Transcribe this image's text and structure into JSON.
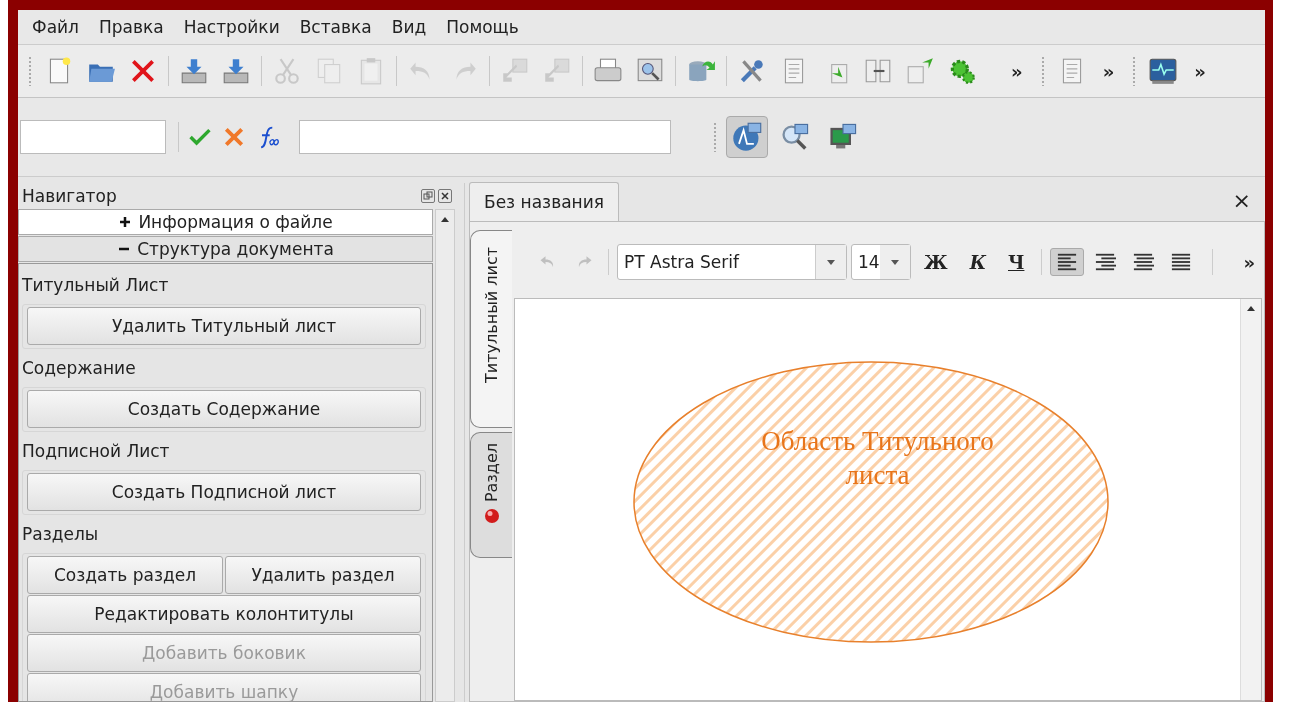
{
  "menu": [
    {
      "label": "Файл"
    },
    {
      "label": "Правка"
    },
    {
      "label": "Настройки"
    },
    {
      "label": "Вставка"
    },
    {
      "label": "Вид"
    },
    {
      "label": "Помощь"
    }
  ],
  "toolbars": [
    {
      "groups": [
        [
          {
            "disabled": false
          },
          {
            "disabled": false
          },
          {
            "disabled": false
          }
        ],
        [
          {
            "disabled": false
          },
          {
            "disabled": false
          }
        ],
        [
          {
            "disabled": true
          },
          {
            "disabled": true
          },
          {
            "disabled": true
          }
        ],
        [
          {
            "disabled": true
          },
          {
            "disabled": true
          }
        ],
        [
          {
            "disabled": true
          },
          {
            "disabled": true
          }
        ],
        [
          {
            "disabled": false
          },
          {
            "disabled": false
          }
        ],
        [
          {
            "disabled": false
          }
        ],
        [
          {
            "disabled": false
          },
          {
            "disabled": false
          },
          {
            "disabled": false
          },
          {
            "disabled": false
          },
          {
            "disabled": false
          },
          {
            "disabled": false
          }
        ]
      ],
      "overflow": "»"
    },
    {
      "groups": [
        [
          {
            "disabled": false
          }
        ]
      ],
      "overflow": "»"
    },
    {
      "groups": [
        [
          {
            "disabled": false
          }
        ]
      ],
      "overflow": "»"
    }
  ],
  "view_buttons": [
    {
      "selected": true
    },
    {
      "selected": false
    },
    {
      "selected": false
    }
  ],
  "navigator": {
    "title": "Навигатор",
    "sections": [
      {
        "label": "Информация о файле",
        "expanded": false
      },
      {
        "label": "Структура документа",
        "expanded": true,
        "groups": [
          {
            "label": "Титульный Лист",
            "rows": [
              [
                {
                  "label": "Удалить Титульный лист",
                  "disabled": false
                }
              ]
            ]
          },
          {
            "label": "Содержание",
            "rows": [
              [
                {
                  "label": "Создать Содержание",
                  "disabled": false
                }
              ]
            ]
          },
          {
            "label": "Подписной Лист",
            "rows": [
              [
                {
                  "label": "Создать Подписной лист",
                  "disabled": false
                }
              ]
            ]
          },
          {
            "label": "Разделы",
            "rows": [
              [
                {
                  "label": "Создать раздел",
                  "disabled": false
                },
                {
                  "label": "Удалить раздел",
                  "disabled": false
                }
              ],
              [
                {
                  "label": "Редактировать колонтитулы",
                  "disabled": false
                }
              ],
              [
                {
                  "label": "Добавить боковик",
                  "disabled": true
                }
              ],
              [
                {
                  "label": "Добавить шапку",
                  "disabled": true
                }
              ]
            ]
          }
        ]
      }
    ]
  },
  "document": {
    "tabs": [
      {
        "label": "Без названия",
        "selected": true
      }
    ],
    "close": "×",
    "side_tabs": [
      {
        "label": "Титульный лист",
        "selected": true
      },
      {
        "label": "Раздел",
        "selected": false
      }
    ],
    "format_bar": {
      "history": [
        {
          "disabled": true
        },
        {
          "disabled": true
        }
      ],
      "font": "PT Astra Serif",
      "size": "14",
      "styles": [
        {
          "kind": "bold",
          "label": "Ж"
        },
        {
          "kind": "italic",
          "label": "К"
        },
        {
          "kind": "underline",
          "label": "Ч"
        }
      ],
      "align": [
        {
          "selected": true
        },
        {
          "selected": false
        },
        {
          "selected": false
        },
        {
          "selected": false
        }
      ],
      "overflow": "»"
    },
    "title_area": "Область Титульного листа"
  }
}
